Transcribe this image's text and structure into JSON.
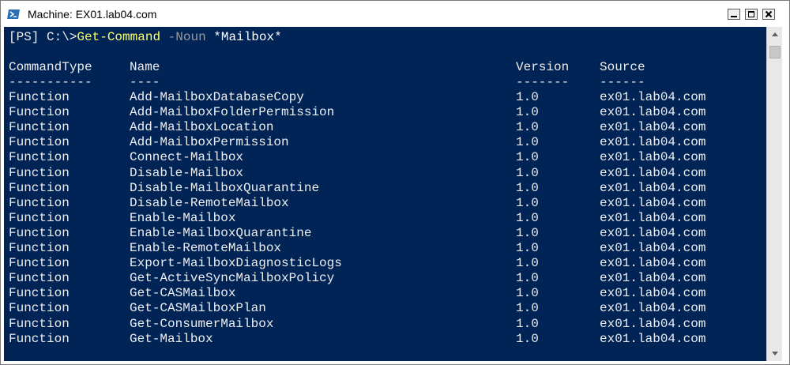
{
  "window": {
    "title": "Machine: EX01.lab04.com",
    "icon": "powershell-icon",
    "controls": [
      "minimize-icon",
      "maximize-icon",
      "close-icon"
    ]
  },
  "console": {
    "background": "#012456",
    "prompt": {
      "prefix": "[PS] C:\\>",
      "command": "Get-Command",
      "parameter": "-Noun",
      "argument": "*Mailbox*"
    },
    "headers": {
      "type": "CommandType",
      "name": "Name",
      "version": "Version",
      "source": "Source"
    },
    "underlines": {
      "type": "-----------",
      "name": "----",
      "version": "-------",
      "source": "------"
    },
    "rows": [
      {
        "type": "Function",
        "name": "Add-MailboxDatabaseCopy",
        "version": "1.0",
        "source": "ex01.lab04.com"
      },
      {
        "type": "Function",
        "name": "Add-MailboxFolderPermission",
        "version": "1.0",
        "source": "ex01.lab04.com"
      },
      {
        "type": "Function",
        "name": "Add-MailboxLocation",
        "version": "1.0",
        "source": "ex01.lab04.com"
      },
      {
        "type": "Function",
        "name": "Add-MailboxPermission",
        "version": "1.0",
        "source": "ex01.lab04.com"
      },
      {
        "type": "Function",
        "name": "Connect-Mailbox",
        "version": "1.0",
        "source": "ex01.lab04.com"
      },
      {
        "type": "Function",
        "name": "Disable-Mailbox",
        "version": "1.0",
        "source": "ex01.lab04.com"
      },
      {
        "type": "Function",
        "name": "Disable-MailboxQuarantine",
        "version": "1.0",
        "source": "ex01.lab04.com"
      },
      {
        "type": "Function",
        "name": "Disable-RemoteMailbox",
        "version": "1.0",
        "source": "ex01.lab04.com"
      },
      {
        "type": "Function",
        "name": "Enable-Mailbox",
        "version": "1.0",
        "source": "ex01.lab04.com"
      },
      {
        "type": "Function",
        "name": "Enable-MailboxQuarantine",
        "version": "1.0",
        "source": "ex01.lab04.com"
      },
      {
        "type": "Function",
        "name": "Enable-RemoteMailbox",
        "version": "1.0",
        "source": "ex01.lab04.com"
      },
      {
        "type": "Function",
        "name": "Export-MailboxDiagnosticLogs",
        "version": "1.0",
        "source": "ex01.lab04.com"
      },
      {
        "type": "Function",
        "name": "Get-ActiveSyncMailboxPolicy",
        "version": "1.0",
        "source": "ex01.lab04.com"
      },
      {
        "type": "Function",
        "name": "Get-CASMailbox",
        "version": "1.0",
        "source": "ex01.lab04.com"
      },
      {
        "type": "Function",
        "name": "Get-CASMailboxPlan",
        "version": "1.0",
        "source": "ex01.lab04.com"
      },
      {
        "type": "Function",
        "name": "Get-ConsumerMailbox",
        "version": "1.0",
        "source": "ex01.lab04.com"
      },
      {
        "type": "Function",
        "name": "Get-Mailbox",
        "version": "1.0",
        "source": "ex01.lab04.com"
      }
    ]
  },
  "scrollbar": {
    "icons": [
      "scroll-up-icon",
      "scroll-down-icon"
    ]
  }
}
